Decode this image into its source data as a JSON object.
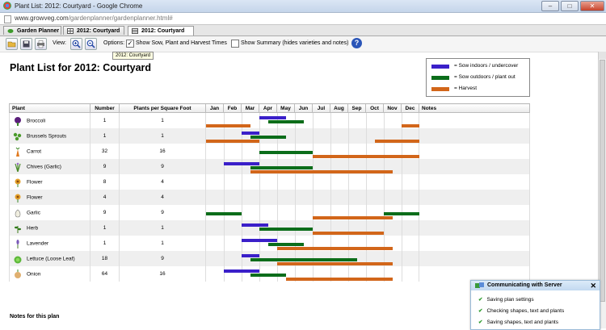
{
  "window": {
    "title": "Plant List: 2012: Courtyard - Google Chrome",
    "min": "‒",
    "max": "□",
    "close": "✕"
  },
  "address": {
    "host": "www.growveg.com",
    "path": "/gardenplanner/gardenplanner.html#"
  },
  "tabs": [
    {
      "label": "Garden Planner"
    },
    {
      "label": "2012: Courtyard"
    },
    {
      "label": "2012: Courtyard"
    }
  ],
  "toolbar": {
    "view_label": "View:",
    "options_label": "Options:",
    "option1": {
      "label": "Show Sow, Plant and Harvest Times",
      "checked": true
    },
    "option2": {
      "label": "Show Summary (hides varieties and notes)",
      "checked": false
    },
    "help": "?"
  },
  "tooltip": "2012: Courtyard",
  "page_title": "Plant List for 2012: Courtyard",
  "legend": [
    {
      "label": "= Sow indoors / undercover",
      "color": "#3a1fc9"
    },
    {
      "label": "= Sow outdoors / plant out",
      "color": "#0b6d1a"
    },
    {
      "label": "= Harvest",
      "color": "#d2661a"
    }
  ],
  "columns": {
    "plant": "Plant",
    "number": "Number",
    "psf": "Plants per Square Foot",
    "months": [
      "Jan",
      "Feb",
      "Mar",
      "Apr",
      "May",
      "Jun",
      "Jul",
      "Aug",
      "Sep",
      "Oct",
      "Nov",
      "Dec"
    ],
    "notes": "Notes"
  },
  "plants": [
    {
      "name": "Broccoli",
      "number": "1",
      "psf": "1",
      "icon": "broccoli-icon",
      "indoor": [
        [
          3.0,
          4.5
        ]
      ],
      "outdoor": [
        [
          3.5,
          5.5
        ]
      ],
      "harvest": [
        [
          0.0,
          2.5
        ],
        [
          11.0,
          12.0
        ]
      ]
    },
    {
      "name": "Brussels Sprouts",
      "number": "1",
      "psf": "1",
      "icon": "brussels-sprouts-icon",
      "indoor": [
        [
          2.0,
          3.0
        ]
      ],
      "outdoor": [
        [
          2.5,
          4.5
        ]
      ],
      "harvest": [
        [
          0.0,
          3.0
        ],
        [
          9.5,
          12.0
        ]
      ]
    },
    {
      "name": "Carrot",
      "number": "32",
      "psf": "16",
      "icon": "carrot-icon",
      "indoor": [],
      "outdoor": [
        [
          3.0,
          6.0
        ]
      ],
      "harvest": [
        [
          6.0,
          12.0
        ]
      ]
    },
    {
      "name": "Chives (Garlic)",
      "number": "9",
      "psf": "9",
      "icon": "chives-icon",
      "indoor": [
        [
          1.0,
          3.0
        ]
      ],
      "outdoor": [
        [
          2.5,
          6.0
        ]
      ],
      "harvest": [
        [
          2.5,
          10.5
        ]
      ]
    },
    {
      "name": "Flower",
      "number": "8",
      "psf": "4",
      "icon": "flower-icon",
      "indoor": [],
      "outdoor": [],
      "harvest": []
    },
    {
      "name": "Flower",
      "number": "4",
      "psf": "4",
      "icon": "flower-icon",
      "indoor": [],
      "outdoor": [],
      "harvest": []
    },
    {
      "name": "Garlic",
      "number": "9",
      "psf": "9",
      "icon": "garlic-icon",
      "indoor": [],
      "outdoor": [
        [
          0.0,
          2.0
        ],
        [
          10.0,
          12.0
        ]
      ],
      "harvest": [
        [
          6.0,
          10.5
        ]
      ]
    },
    {
      "name": "Herb",
      "number": "1",
      "psf": "1",
      "icon": "herb-icon",
      "indoor": [
        [
          2.0,
          3.5
        ]
      ],
      "outdoor": [
        [
          3.0,
          6.0
        ]
      ],
      "harvest": [
        [
          6.0,
          10.0
        ]
      ]
    },
    {
      "name": "Lavender",
      "number": "1",
      "psf": "1",
      "icon": "lavender-icon",
      "indoor": [
        [
          2.0,
          4.0
        ]
      ],
      "outdoor": [
        [
          3.5,
          5.5
        ]
      ],
      "harvest": [
        [
          4.0,
          10.5
        ]
      ]
    },
    {
      "name": "Lettuce (Loose Leaf)",
      "number": "18",
      "psf": "9",
      "icon": "lettuce-icon",
      "indoor": [
        [
          2.0,
          3.0
        ]
      ],
      "outdoor": [
        [
          2.5,
          8.5
        ]
      ],
      "harvest": [
        [
          4.0,
          10.5
        ]
      ]
    },
    {
      "name": "Onion",
      "number": "64",
      "psf": "16",
      "icon": "onion-icon",
      "indoor": [
        [
          1.0,
          3.0
        ]
      ],
      "outdoor": [
        [
          2.5,
          4.5
        ]
      ],
      "harvest": [
        [
          4.5,
          10.5
        ]
      ]
    }
  ],
  "notes_heading": "Notes for this plan",
  "server_popup": {
    "title": "Communicating with Server",
    "close": "✕",
    "items": [
      "Saving plan settings",
      "Checking shapes, text and plants",
      "Saving shapes, text and plants"
    ],
    "check": "✔"
  }
}
